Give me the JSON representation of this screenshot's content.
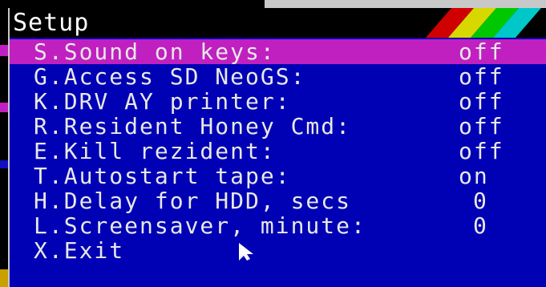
{
  "window": {
    "title": "Setup"
  },
  "colors": {
    "background": "#0000b4",
    "highlight": "#c020c0",
    "titlebar": "#000000",
    "text": "#e8e8e8"
  },
  "menu": {
    "items": [
      {
        "label": "S.Sound on keys:",
        "value": "off",
        "selected": true
      },
      {
        "label": "G.Access SD NeoGS:",
        "value": "off"
      },
      {
        "label": "K.DRV AY printer:",
        "value": "off"
      },
      {
        "label": "R.Resident Honey Cmd:",
        "value": "off"
      },
      {
        "label": "E.Kill rezident:",
        "value": "off"
      },
      {
        "label": "T.Autostart tape:",
        "value": "on"
      },
      {
        "label": "H.Delay for HDD, secs",
        "value": "0"
      },
      {
        "label": "L.Screensaver, minute:",
        "value": "0"
      },
      {
        "label": "X.Exit",
        "value": ""
      }
    ]
  },
  "icons": {
    "cursor": "pointer-arrow-icon",
    "stripes": "rainbow-stripes-icon"
  }
}
